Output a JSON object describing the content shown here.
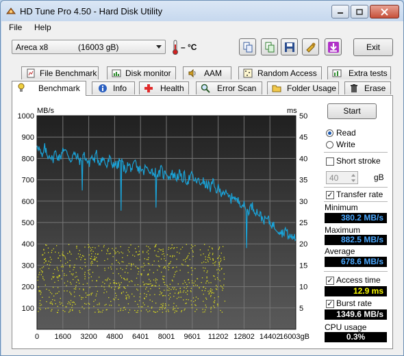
{
  "window": {
    "title": "HD Tune Pro 4.50 - Hard Disk Utility"
  },
  "menu": {
    "file": "File",
    "help": "Help"
  },
  "toolbar": {
    "drive_model": "Areca   x8",
    "drive_capacity": "(16003 gB)",
    "temperature": "– °C",
    "exit_label": "Exit",
    "icons": [
      "copy-icon",
      "copy-screenshot-icon",
      "save-icon",
      "options-icon",
      "download-icon"
    ]
  },
  "tabs_row1": [
    {
      "label": "File Benchmark",
      "icon": "file-benchmark-icon"
    },
    {
      "label": "Disk monitor",
      "icon": "disk-monitor-icon"
    },
    {
      "label": "AAM",
      "icon": "speaker-icon"
    },
    {
      "label": "Random Access",
      "icon": "random-access-icon"
    },
    {
      "label": "Extra tests",
      "icon": "extra-tests-icon"
    }
  ],
  "tabs_row2": [
    {
      "label": "Benchmark",
      "icon": "benchmark-icon",
      "active": true
    },
    {
      "label": "Info",
      "icon": "info-icon"
    },
    {
      "label": "Health",
      "icon": "health-icon"
    },
    {
      "label": "Error Scan",
      "icon": "magnifier-icon"
    },
    {
      "label": "Folder Usage",
      "icon": "folder-icon"
    },
    {
      "label": "Erase",
      "icon": "trash-icon"
    }
  ],
  "controls": {
    "start_label": "Start",
    "read_label": "Read",
    "write_label": "Write",
    "mode_selected": "Read",
    "short_stroke_label": "Short stroke",
    "short_stroke_checked": false,
    "short_stroke_value": "40",
    "short_stroke_unit": "gB",
    "transfer_rate_label": "Transfer rate",
    "transfer_rate_checked": true,
    "access_time_label": "Access time",
    "access_time_checked": true,
    "burst_rate_label": "Burst rate",
    "burst_rate_checked": true
  },
  "stats": {
    "minimum_label": "Minimum",
    "minimum_value": "380.2 MB/s",
    "maximum_label": "Maximum",
    "maximum_value": "882.5 MB/s",
    "average_label": "Average",
    "average_value": "678.6 MB/s",
    "access_time_value": "12.9 ms",
    "burst_rate_value": "1349.6 MB/s",
    "cpu_usage_label": "CPU usage",
    "cpu_usage_value": "0.3%"
  },
  "colors": {
    "transfer_line": "#1aa3d8",
    "access_dots": "#e3e31a",
    "plot_bg_top": "#202020",
    "plot_bg_bottom": "#585858",
    "grid": "#777777"
  },
  "chart_data": {
    "type": "line",
    "left_unit": "MB/s",
    "right_unit": "ms",
    "left_ticks": [
      "1000",
      "900",
      "800",
      "700",
      "600",
      "500",
      "400",
      "300",
      "200",
      "100"
    ],
    "right_ticks": [
      "50",
      "45",
      "40",
      "35",
      "30",
      "25",
      "20",
      "15",
      "10",
      "5"
    ],
    "x_ticks": [
      "0",
      "1600",
      "3200",
      "4800",
      "6401",
      "8001",
      "9601",
      "11202",
      "12802",
      "14402",
      "16003gB"
    ],
    "ylim_left": [
      0,
      1000
    ],
    "ylim_right": [
      0,
      50
    ],
    "xlim": [
      0,
      16003
    ],
    "series": [
      {
        "kind": "transfer-rate",
        "x": [
          0,
          160,
          320,
          480,
          640,
          800,
          960,
          1120,
          1280,
          1440,
          1600,
          1760,
          1920,
          2080,
          2240,
          2400,
          2560,
          2720,
          2880,
          3040,
          3200,
          3360,
          3520,
          3680,
          3840,
          4000,
          4160,
          4320,
          4480,
          4640,
          4800,
          4960,
          5120,
          5280,
          5440,
          5600,
          5760,
          5920,
          6080,
          6240,
          6401,
          6560,
          6720,
          6880,
          7040,
          7200,
          7360,
          7520,
          7680,
          7840,
          8001,
          8160,
          8320,
          8480,
          8640,
          8800,
          8960,
          9120,
          9280,
          9440,
          9601,
          9760,
          9920,
          10080,
          10240,
          10400,
          10560,
          10720,
          10880,
          11040,
          11202,
          11360,
          11520,
          11680,
          11840,
          12000,
          12160,
          12320,
          12480,
          12640,
          12802,
          12960,
          13120,
          13280,
          13440,
          13600,
          13760,
          13920,
          14080,
          14240,
          14402,
          14560,
          14720,
          14880,
          15040,
          15200,
          15360,
          15520,
          15680,
          15840,
          16003
        ],
        "y": [
          870,
          840,
          800,
          850,
          810,
          820,
          790,
          830,
          810,
          800,
          850,
          830,
          820,
          790,
          820,
          810,
          800,
          780,
          820,
          800,
          770,
          810,
          790,
          820,
          780,
          800,
          790,
          760,
          800,
          770,
          780,
          760,
          790,
          780,
          740,
          770,
          760,
          750,
          780,
          740,
          760,
          730,
          760,
          740,
          750,
          730,
          740,
          720,
          750,
          720,
          740,
          710,
          730,
          720,
          710,
          730,
          700,
          720,
          690,
          710,
          720,
          690,
          700,
          680,
          700,
          670,
          680,
          660,
          690,
          650,
          660,
          640,
          650,
          630,
          620,
          610,
          630,
          600,
          600,
          590,
          580,
          550,
          560,
          580,
          560,
          550,
          540,
          520,
          510,
          520,
          500,
          490,
          480,
          470,
          460,
          450,
          470,
          440,
          430,
          440,
          420
        ]
      },
      {
        "kind": "access-time",
        "axis": "right",
        "range_ms": [
          4,
          20
        ],
        "x_range": [
          0,
          11600
        ],
        "count": 900
      }
    ],
    "dips": [
      {
        "x": 2800,
        "y": 650
      },
      {
        "x": 5200,
        "y": 555
      },
      {
        "x": 7350,
        "y": 570
      },
      {
        "x": 12950,
        "y": 380
      },
      {
        "x": 15800,
        "y": 420
      }
    ],
    "grid": true,
    "legend": ""
  }
}
